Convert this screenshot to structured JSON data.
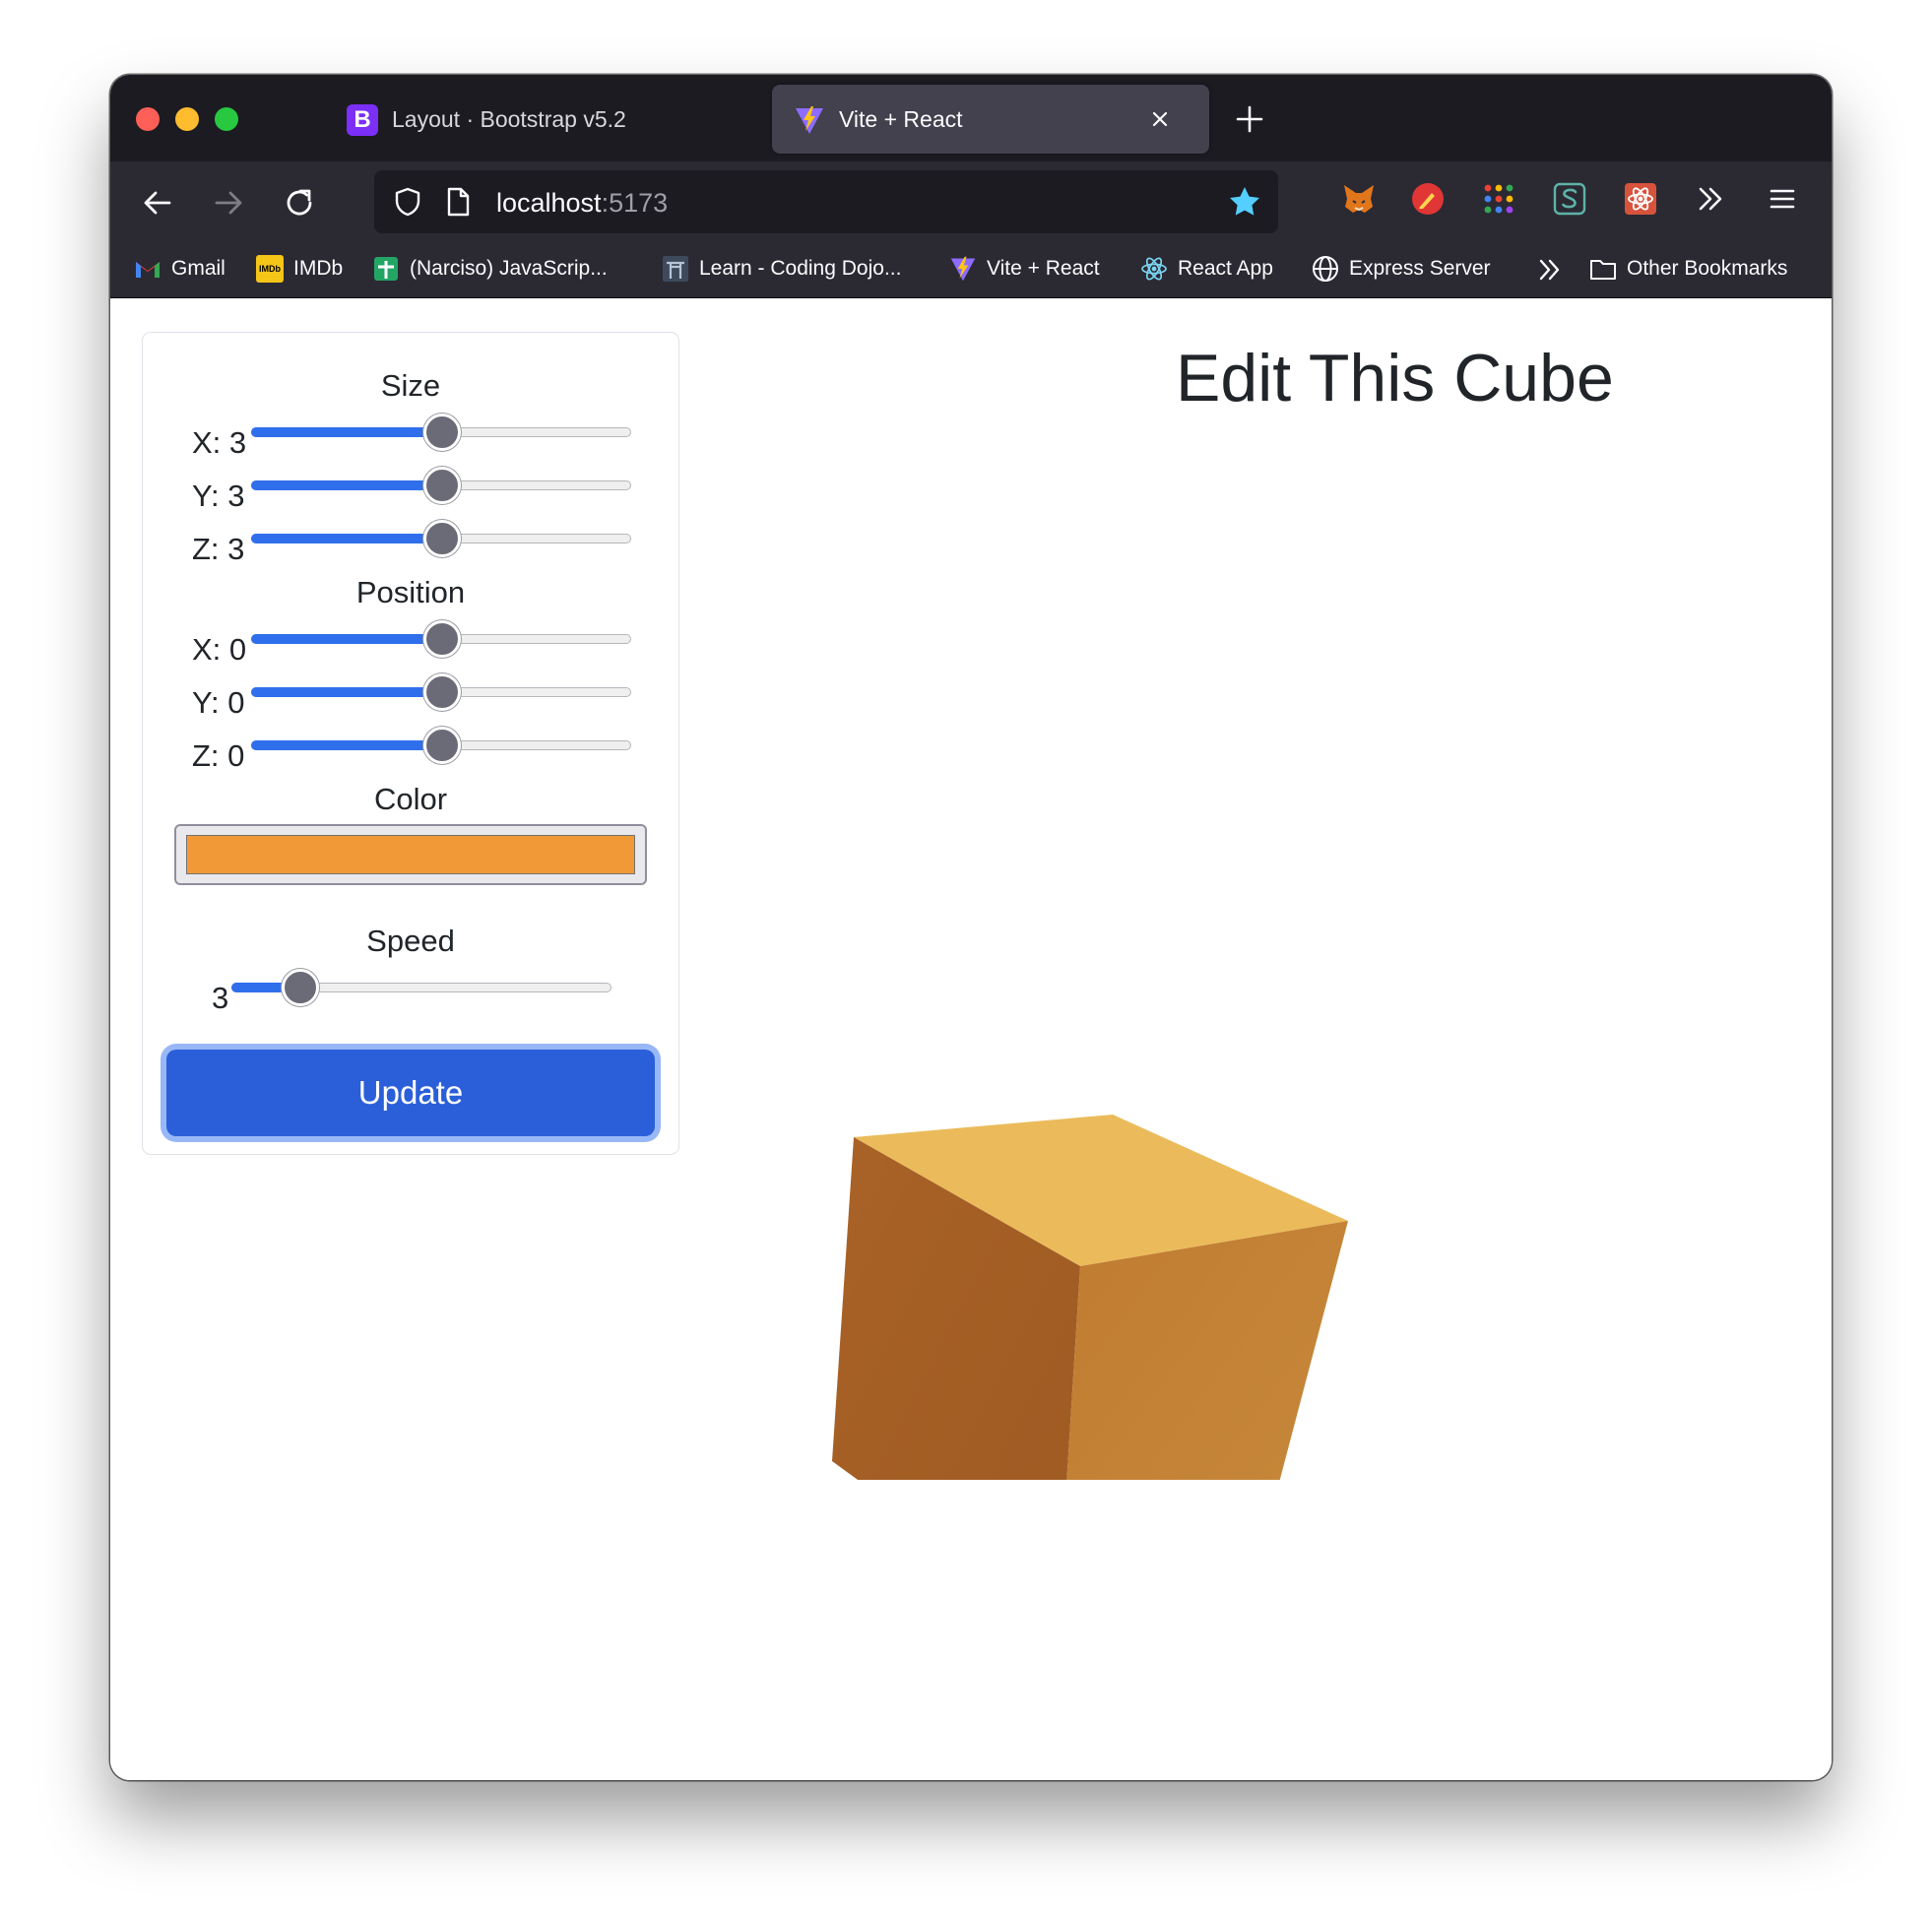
{
  "browser": {
    "tabs": [
      {
        "title": "Layout · Bootstrap v5.2",
        "icon": "bootstrap-icon",
        "active": false
      },
      {
        "title": "Vite + React",
        "icon": "vite-icon",
        "active": true
      }
    ],
    "url": {
      "host": "localhost",
      "port": ":5173"
    },
    "bookmarks": [
      {
        "label": "Gmail",
        "icon": "gmail-icon"
      },
      {
        "label": "IMDb",
        "icon": "imdb-icon"
      },
      {
        "label": "(Narciso) JavaScrip...",
        "icon": "sheets-icon"
      },
      {
        "label": "Learn - Coding Dojo...",
        "icon": "dojo-icon"
      },
      {
        "label": "Vite + React",
        "icon": "vite-icon"
      },
      {
        "label": "React App",
        "icon": "react-icon"
      },
      {
        "label": "Express Server",
        "icon": "globe-icon"
      },
      {
        "label": "Other Bookmarks",
        "icon": "folder-icon"
      }
    ],
    "imdb_logo_text": "IMDb"
  },
  "controls": {
    "size": {
      "title": "Size",
      "sliders": [
        {
          "label": "X: 3",
          "fraction": 0.5
        },
        {
          "label": "Y: 3",
          "fraction": 0.5
        },
        {
          "label": "Z: 3",
          "fraction": 0.5
        }
      ]
    },
    "position": {
      "title": "Position",
      "sliders": [
        {
          "label": "X: 0",
          "fraction": 0.5
        },
        {
          "label": "Y: 0",
          "fraction": 0.5
        },
        {
          "label": "Z: 0",
          "fraction": 0.5
        }
      ]
    },
    "color": {
      "title": "Color",
      "value": "#f29937"
    },
    "speed": {
      "title": "Speed",
      "label": "3",
      "fraction": 0.18
    },
    "update_label": "Update"
  },
  "main": {
    "heading": "Edit This Cube",
    "cube": {
      "top": "#ebbb5b",
      "left": "#a96227",
      "right": "#c07c31"
    }
  },
  "colors": {
    "accent": "#2b5fd9",
    "star": "#54ffbd"
  }
}
